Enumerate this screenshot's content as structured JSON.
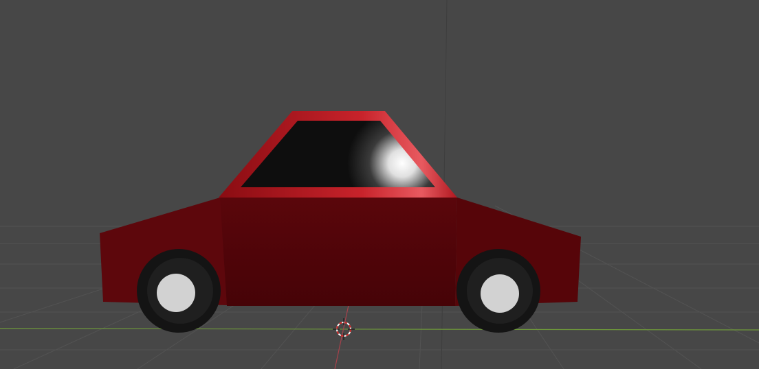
{
  "viewport": {
    "background_color": "#474747",
    "grid_color": "#535353",
    "x_axis_color": "#6f9a3a",
    "y_axis_color": "#a8414b"
  },
  "car": {
    "body_color": "#520509",
    "cabin_color": "#b4141c",
    "window_color": "#0e0e0e",
    "tire_color": "#141414",
    "hub_color": "#d2d2d2"
  },
  "cursor": {
    "icon": "3d-cursor-icon"
  }
}
